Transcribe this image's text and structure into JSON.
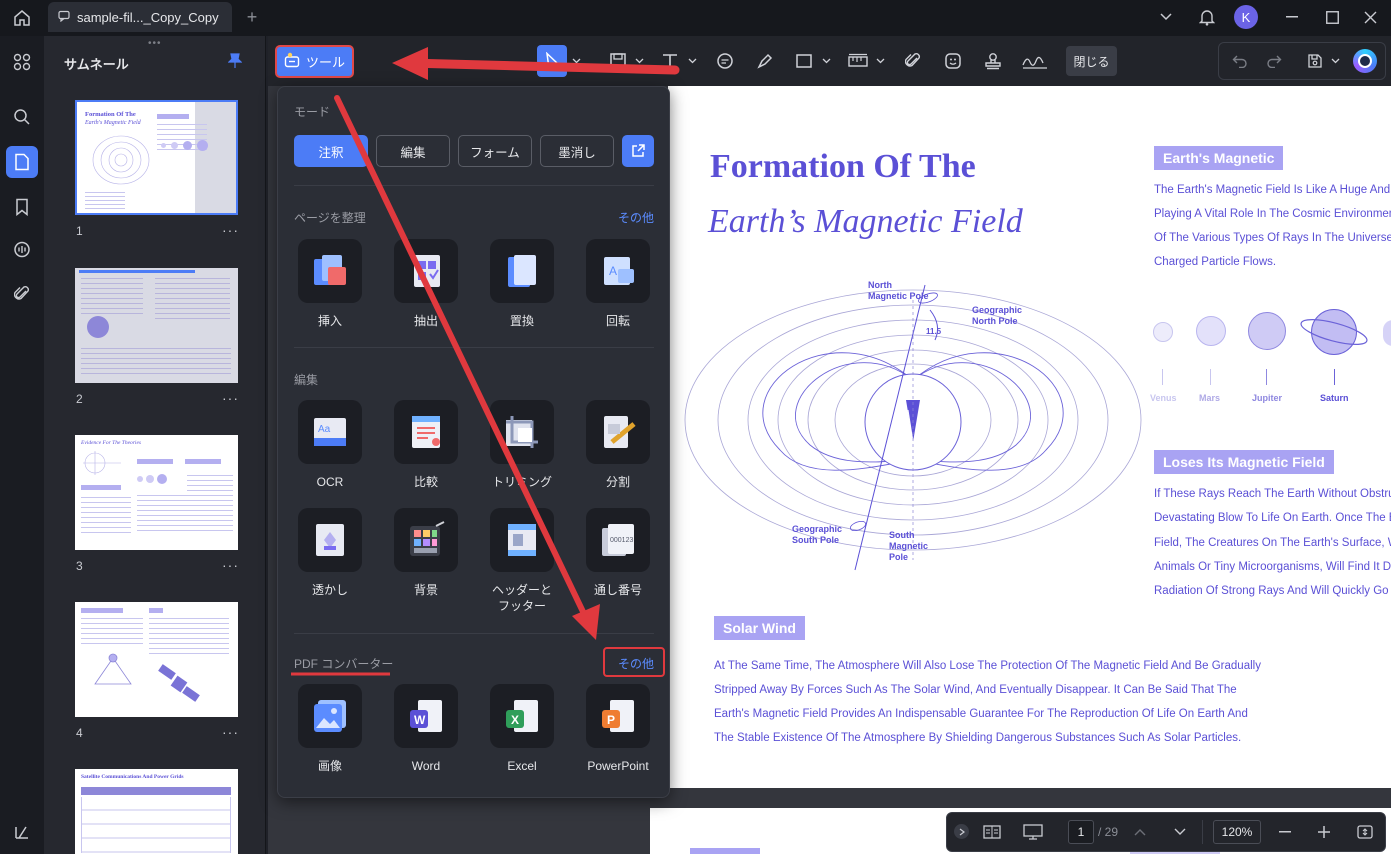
{
  "titlebar": {
    "tab_title": "sample-fil..._Copy_Copy",
    "avatar_initial": "K"
  },
  "thumbnails": {
    "title": "サムネール",
    "pages": [
      "1",
      "2",
      "3",
      "4"
    ],
    "more_glyph": "···",
    "thumb_titles": [
      "Formation Of The",
      "Earth's Magnetic Field",
      "Evidence For The Theories",
      "Satellite Communications And Power Grids"
    ]
  },
  "toolbar": {
    "tools_label": "ツール",
    "close_label": "閉じる"
  },
  "tools_panel": {
    "mode_heading": "モード",
    "modes": [
      "注釈",
      "編集",
      "フォーム",
      "墨消し"
    ],
    "organize_heading": "ページを整理",
    "organize_more": "その他",
    "organize_items": [
      "挿入",
      "抽出",
      "置換",
      "回転"
    ],
    "edit_heading": "編集",
    "edit_items": [
      "OCR",
      "比較",
      "トリミング",
      "分割",
      "透かし",
      "背景",
      "ヘッダーと\nフッター",
      "通し番号"
    ],
    "convert_heading": "PDF コンバーター",
    "convert_more": "その他",
    "convert_items": [
      "画像",
      "Word",
      "Excel",
      "PowerPoint"
    ]
  },
  "document": {
    "title_line1": "Formation Of The",
    "title_line2": "Earth’s Magnetic Field",
    "section1": {
      "label": "Earth's Magnetic",
      "lines": [
        "The Earth's Magnetic Field Is Like A Huge And",
        "Playing A Vital Role In The Cosmic Environmen",
        "Of The Various Types Of Rays In The Universe",
        "Charged Particle Flows."
      ]
    },
    "planets": [
      "Venus",
      "Mars",
      "Jupiter",
      "Saturn"
    ],
    "diagram_labels": {
      "north_magnetic": "North\nMagnetic Pole",
      "geo_north": "Geographic\nNorth Pole",
      "angle": "11.5",
      "geo_south": "Geographic\nSouth Pole",
      "south_magnetic": "South\nMagnetic\nPole"
    },
    "section2": {
      "label": "Loses Its Magnetic Field",
      "lines": [
        "If These Rays Reach The Earth Without Obstru",
        "Devastating Blow To Life On Earth. Once The E",
        "Field, The Creatures On The Earth's Surface, W",
        "Animals Or Tiny Microorganisms, Will Find It Di",
        "Radiation Of Strong Rays And Will Quickly Go T"
      ]
    },
    "section3": {
      "label": "Solar Wind",
      "lines": [
        "At The Same Time, The Atmosphere Will Also Lose The Protection Of The Magnetic Field And Be Gradually",
        "Stripped Away By Forces Such As The Solar Wind, And Eventually Disappear. It Can Be Said That The",
        "Earth's Magnetic Field Provides An Indispensable Guarantee For The Reproduction Of Life On Earth And",
        "The Stable Existence Of The Atmosphere By Shielding Dangerous Substances Such As Solar Particles."
      ]
    }
  },
  "navigation": {
    "current_page": "1",
    "total_pages": "/ 29",
    "zoom": "120%"
  },
  "colors": {
    "accent": "#4c7cf6",
    "annotation_red": "#e0393e",
    "doc_purple": "#5b50d6"
  }
}
